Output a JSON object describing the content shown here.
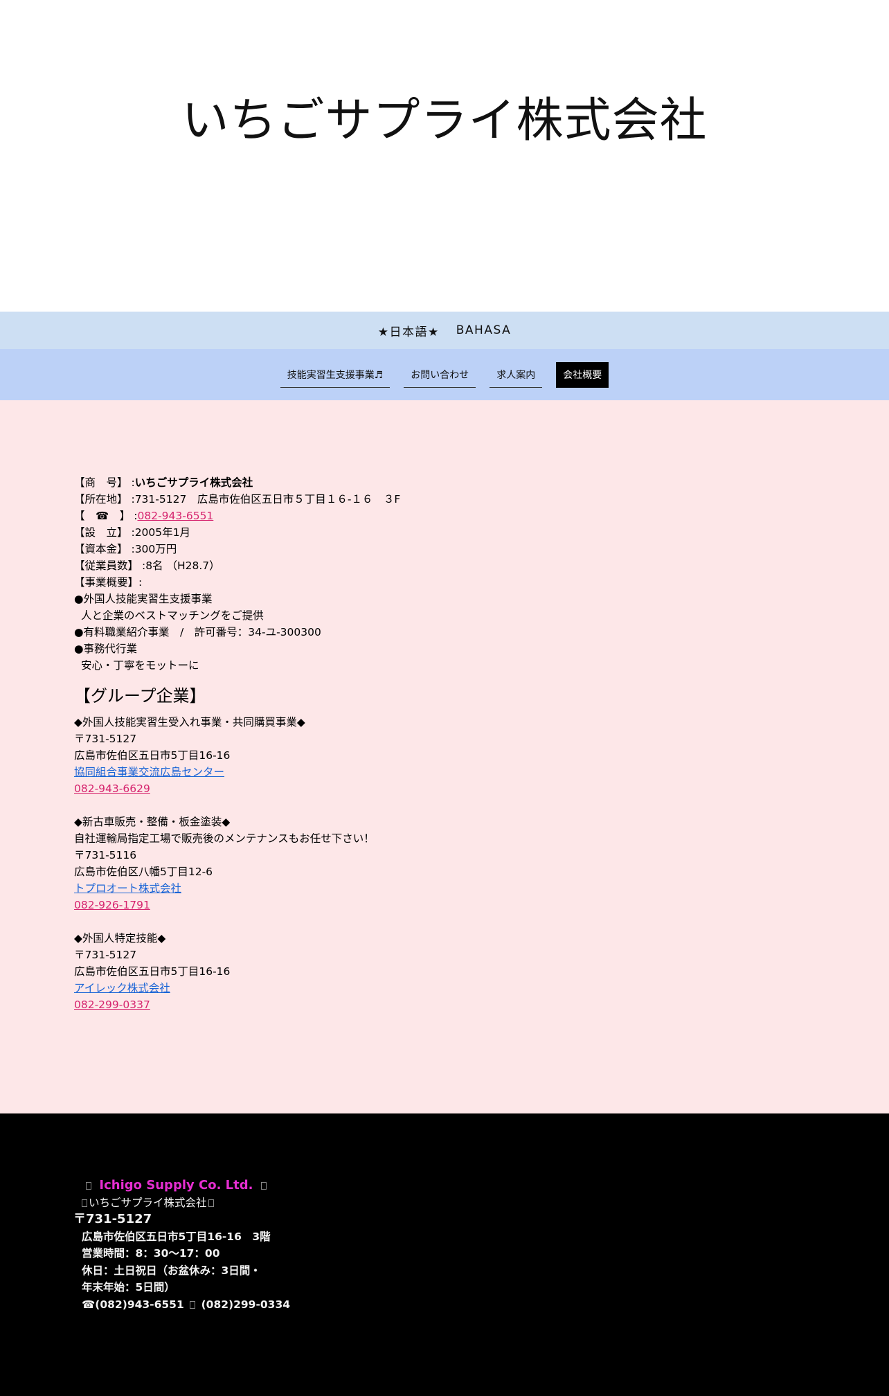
{
  "header": {
    "title": "いちごサプライ株式会社"
  },
  "lang_bar": {
    "japanese": "★日本語★",
    "bahasa": "BAHASA"
  },
  "nav": {
    "items": [
      "技能実習生支援事業♬",
      "お問い合わせ",
      "求人案内",
      "会社概要"
    ],
    "active": "会社概要"
  },
  "company": {
    "name_label": "【商　号】",
    "name_value": "いちごサプライ株式会社",
    "address_label": "【所在地】",
    "address_value": "731-5127　広島市佐伯区五日市５丁目１６-１６　３F",
    "tel_label": "【　☎　】",
    "tel_value": "082-943-6551",
    "established_label": "【設　立】",
    "established_value": "2005年1月",
    "capital_label": "【資本金】",
    "capital_value": "300万円",
    "employees_label": "【従業員数】",
    "employees_value": "8名 （H28.7）",
    "business_label": "【事業概要】",
    "business_items": [
      "●外国人技能実習生支援事業",
      "人と企業のベストマッチングをご提供",
      "●有料職業紹介事業　/　許可番号：34-ユ-300300",
      "●事務代行業",
      "安心・丁寧をモットーに"
    ]
  },
  "group": {
    "title": "【グループ企業】",
    "entries": [
      {
        "heading": "◆外国人技能実習生受入れ事業・共同購買事業◆",
        "note": "",
        "postal": "〒731-5127",
        "address": "広島市佐伯区五日市5丁目16-16",
        "company": "協同組合事業交流広島センター",
        "tel": "082-943-6629"
      },
      {
        "heading": "◆新古車販売・整備・板金塗装◆",
        "note": "自社運輸局指定工場で販売後のメンテナンスもお任せ下さい！",
        "postal": "〒731-5116",
        "address": "広島市佐伯区八幡5丁目12-6",
        "company": "トプロオート株式会社",
        "tel": "082-926-1791"
      },
      {
        "heading": "◆外国人特定技能◆",
        "note": "",
        "postal": "〒731-5127",
        "address": "広島市佐伯区五日市5丁目16-16",
        "company": "アイレック株式会社",
        "tel": "082-299-0337"
      }
    ]
  },
  "footer": {
    "brand": "Ichigo Supply Co. Ltd.",
    "name": "いちごサプライ株式会社",
    "postal": "〒731-5127",
    "address": "広島市佐伯区五日市5丁目16-16　3階",
    "hours": "営業時間：8：30〜17：00",
    "holidays_1": "休日：土日祝日（お盆休み：3日間・",
    "holidays_2": "年末年始：5日間）",
    "tel": "☎(082)943-6551",
    "fax": "(082)299-0334"
  }
}
